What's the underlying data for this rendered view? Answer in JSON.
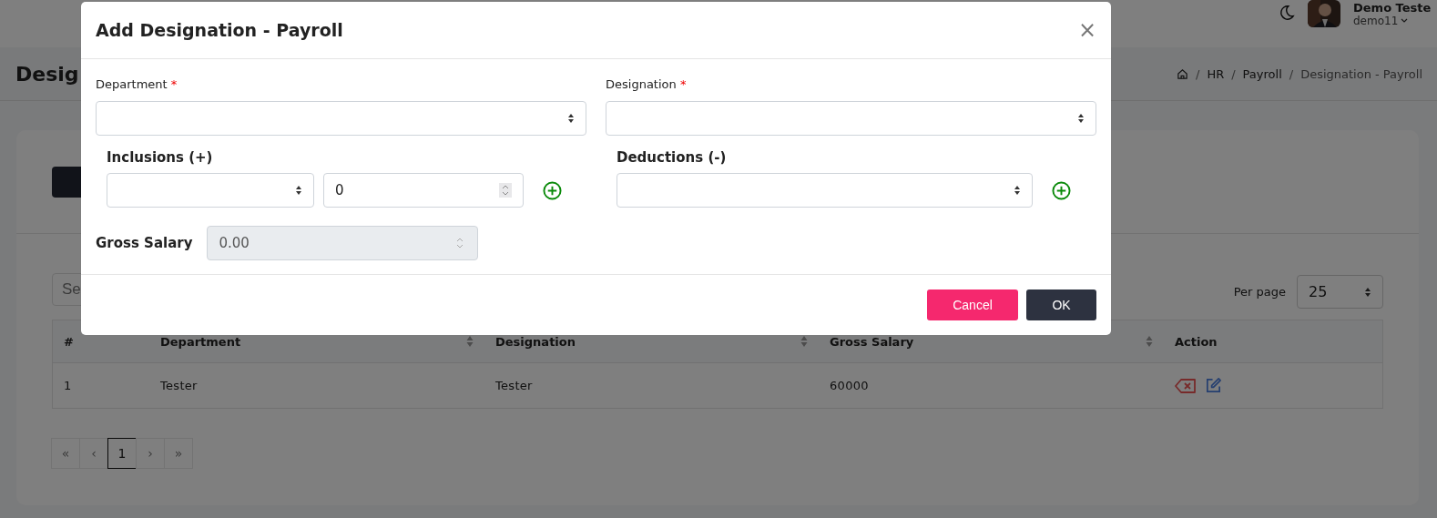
{
  "header": {
    "user_name": "Demo Teste",
    "username": "demo11"
  },
  "page": {
    "title": "Desig",
    "breadcrumb": [
      {
        "kind": "separator",
        "text": "/"
      },
      {
        "kind": "link",
        "text": "HR"
      },
      {
        "kind": "separator",
        "text": "/"
      },
      {
        "kind": "link",
        "text": "Payroll"
      },
      {
        "kind": "separator",
        "text": "/"
      },
      {
        "kind": "current",
        "text": "Designation - Payroll"
      }
    ]
  },
  "search": {
    "placeholder": "Se"
  },
  "per_page": {
    "label": "Per page",
    "value": "25"
  },
  "table": {
    "columns": [
      {
        "label": "#",
        "sortable": false
      },
      {
        "label": "Department",
        "sortable": true
      },
      {
        "label": "Designation",
        "sortable": true
      },
      {
        "label": "Gross Salary",
        "sortable": true
      },
      {
        "label": "Action",
        "sortable": false
      }
    ],
    "rows": [
      {
        "cells": [
          "1",
          "Tester",
          "Tester",
          "60000"
        ]
      }
    ]
  },
  "pagination": [
    {
      "label": "«",
      "selected": false
    },
    {
      "label": "‹",
      "selected": false
    },
    {
      "label": "1",
      "selected": true
    },
    {
      "label": "›",
      "selected": false
    },
    {
      "label": "»",
      "selected": false
    }
  ],
  "modal": {
    "title": "Add Designation - Payroll",
    "close": "×",
    "fields": [
      {
        "label": "Department",
        "required_mark": "*"
      },
      {
        "label": "Designation",
        "required_mark": "*"
      }
    ],
    "inclusions": {
      "label": "Inclusions (+)",
      "amount": "0"
    },
    "deductions": {
      "label": "Deductions (-)"
    },
    "gross_salary": {
      "label": "Gross Salary",
      "value": "0.00",
      "disabled": true
    },
    "buttons": [
      {
        "label": "Cancel",
        "kind": "cancel"
      },
      {
        "label": "OK",
        "kind": "ok"
      }
    ]
  }
}
